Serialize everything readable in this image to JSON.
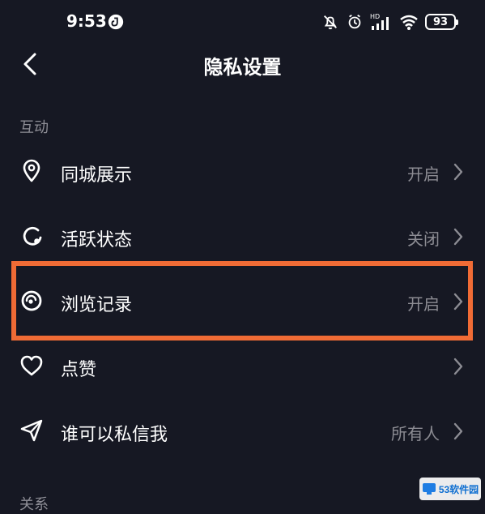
{
  "status_bar": {
    "time": "9:53",
    "battery": "93",
    "network_label": "HD",
    "icons": [
      "notification-off-icon",
      "alarm-icon",
      "signal-icon",
      "wifi-icon",
      "battery-icon"
    ]
  },
  "header": {
    "title": "隐私设置",
    "back_icon": "chevron-left-icon"
  },
  "sections": [
    {
      "label": "互动",
      "items": [
        {
          "label": "同城展示",
          "value": "开启",
          "icon": "location-pin-icon"
        },
        {
          "label": "活跃状态",
          "value": "关闭",
          "icon": "activity-status-icon"
        },
        {
          "label": "浏览记录",
          "value": "开启",
          "icon": "eye-icon",
          "highlighted": true
        },
        {
          "label": "点赞",
          "value": "",
          "icon": "heart-icon"
        },
        {
          "label": "谁可以私信我",
          "value": "所有人",
          "icon": "send-message-icon"
        }
      ]
    },
    {
      "label": "关系",
      "items": []
    }
  ],
  "colors": {
    "background": "#161823",
    "text": "#ffffff",
    "muted_text": "#8c8c93",
    "highlight": "#f06b35"
  },
  "watermark": {
    "text": "53软件园"
  }
}
